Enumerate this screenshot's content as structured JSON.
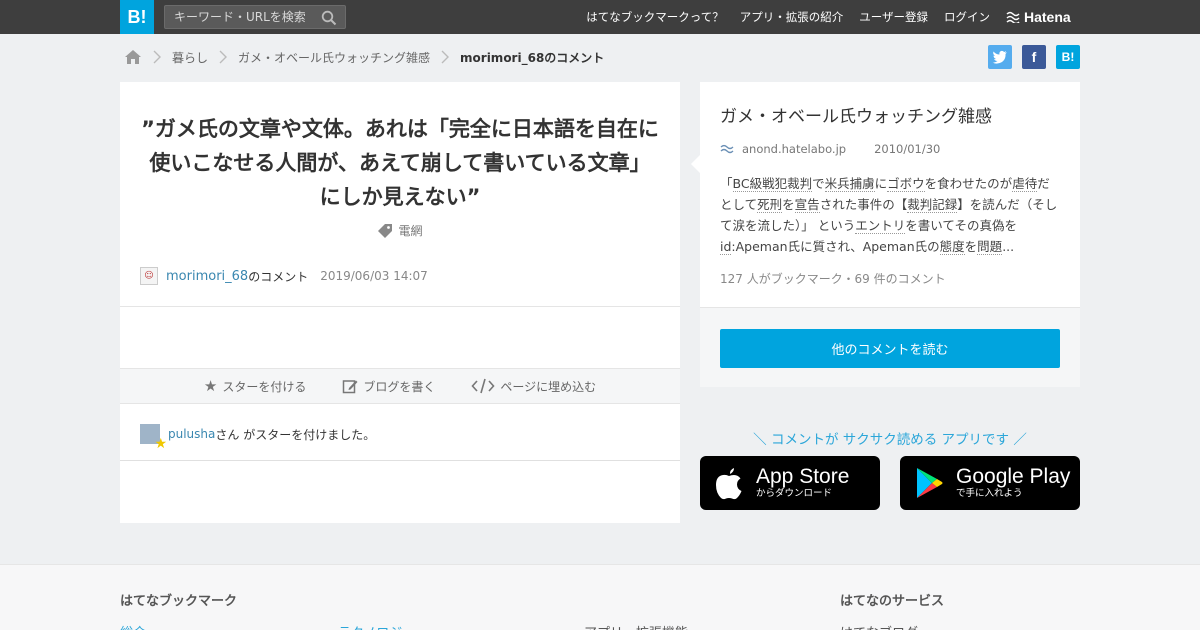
{
  "header": {
    "logo": "B!",
    "search_placeholder": "キーワード・URLを検索",
    "nav": [
      "はてなブックマークって？",
      "アプリ・拡張の紹介",
      "ユーザー登録",
      "ログイン"
    ],
    "brand": "Hatena"
  },
  "breadcrumb": {
    "items": [
      "暮らし",
      "ガメ・オベール氏ウォッチング雑感"
    ],
    "current": "morimori_68のコメント"
  },
  "share": {
    "twitter": "t",
    "facebook": "f",
    "hatena": "B!"
  },
  "comment": {
    "text": "”ガメ氏の文章や文体。あれは「完全に日本語を自在に使いこなせる人間が、あえて崩して書いている文章」にしか見えない”",
    "tag": "電網",
    "user": "morimori_68",
    "user_suffix": "のコメント",
    "date": "2019/06/03 14:07"
  },
  "actions": {
    "star": "スターを付ける",
    "blog": "ブログを書く",
    "embed": "ページに埋め込む"
  },
  "star_event": {
    "user": "pulusha",
    "text": "さん がスターを付けました。"
  },
  "entry": {
    "title": "ガメ・オベール氏ウォッチング雑感",
    "domain": "anond.hatelabo.jp",
    "date": "2010/01/30",
    "desc_parts": [
      {
        "t": "「",
        "k": false
      },
      {
        "t": "BC級戦犯裁判",
        "k": true
      },
      {
        "t": "で",
        "k": false
      },
      {
        "t": "米兵捕虜",
        "k": true
      },
      {
        "t": "に",
        "k": false
      },
      {
        "t": "ゴボウ",
        "k": true
      },
      {
        "t": "を食わせたのが",
        "k": false
      },
      {
        "t": "虐待",
        "k": true
      },
      {
        "t": "だとして",
        "k": false
      },
      {
        "t": "死刑",
        "k": true
      },
      {
        "t": "を",
        "k": false
      },
      {
        "t": "宣告",
        "k": true
      },
      {
        "t": "された事件の【",
        "k": false
      },
      {
        "t": "裁判記録",
        "k": true
      },
      {
        "t": "】を読んだ（そして涙を流した）」 という",
        "k": false
      },
      {
        "t": "エントリ",
        "k": true
      },
      {
        "t": "を書いてその真偽を",
        "k": false
      },
      {
        "t": "id",
        "k": true
      },
      {
        "t": ":Apeman氏に質され、Apeman氏の",
        "k": false
      },
      {
        "t": "態度",
        "k": true
      },
      {
        "t": "を",
        "k": false
      },
      {
        "t": "問題",
        "k": true
      },
      {
        "t": "...",
        "k": false
      }
    ],
    "count": "127 人がブックマーク・69 件のコメント",
    "button": "他のコメントを読む"
  },
  "promo": {
    "text": "＼ コメントが サクサク読める アプリです ／",
    "appstore_big": "App Store",
    "appstore_small": "からダウンロード",
    "gplay_big": "Google Play",
    "gplay_small": "で手に入れよう"
  },
  "footer": {
    "heading1": "はてなブックマーク",
    "heading2": "はてなのサービス",
    "links": [
      "総合",
      "テクノロジー",
      "アプリ・拡張機能",
      "はてなブログ"
    ]
  },
  "colors": {
    "accent": "#00a4de",
    "header": "#3e3e3e",
    "twitter": "#55acee",
    "facebook": "#3b5998"
  }
}
